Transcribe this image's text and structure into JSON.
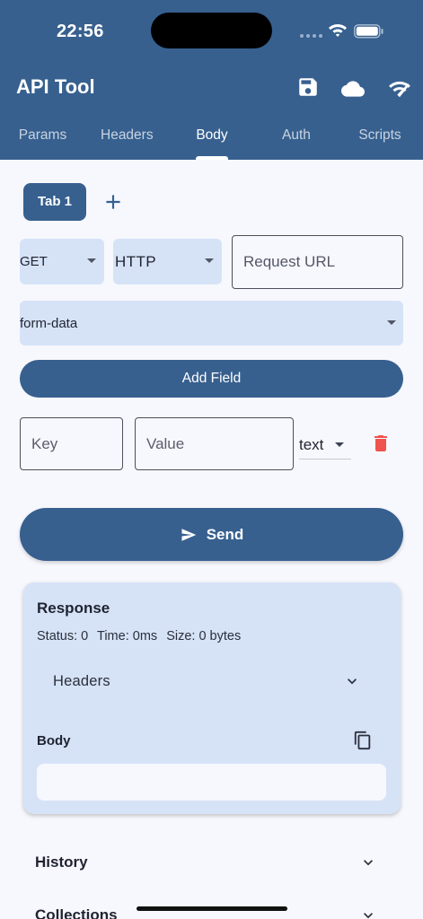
{
  "status_bar": {
    "time": "22:56",
    "icons": [
      "signal-dots-icon",
      "wifi-icon",
      "battery-icon"
    ]
  },
  "app_bar": {
    "title": "API Tool",
    "actions": [
      "save-icon",
      "cloud-icon",
      "network-signal-icon"
    ],
    "tabs": [
      {
        "label": "Params",
        "active": false
      },
      {
        "label": "Headers",
        "active": false
      },
      {
        "label": "Body",
        "active": true
      },
      {
        "label": "Auth",
        "active": false
      },
      {
        "label": "Scripts",
        "active": false
      }
    ]
  },
  "request": {
    "tab_label": "Tab 1",
    "add_tab_icon": "plus-icon",
    "method": "GET",
    "protocol": "HTTP",
    "url_placeholder": "Request URL",
    "url_value": "",
    "body_type": "form-data",
    "add_field_label": "Add Field",
    "fields": [
      {
        "key_placeholder": "Key",
        "value_placeholder": "Value",
        "type": "text"
      }
    ],
    "send_label": "Send"
  },
  "response": {
    "title": "Response",
    "status": "Status: 0",
    "time": "Time: 0ms",
    "size": "Size: 0 bytes",
    "headers_label": "Headers",
    "body_label": "Body",
    "body_value": ""
  },
  "sections": [
    {
      "label": "History"
    },
    {
      "label": "Collections"
    }
  ],
  "colors": {
    "primary": "#37608f",
    "surface_tint": "#d6e3f7",
    "background": "#f7f8fd",
    "danger": "#ef5350"
  }
}
